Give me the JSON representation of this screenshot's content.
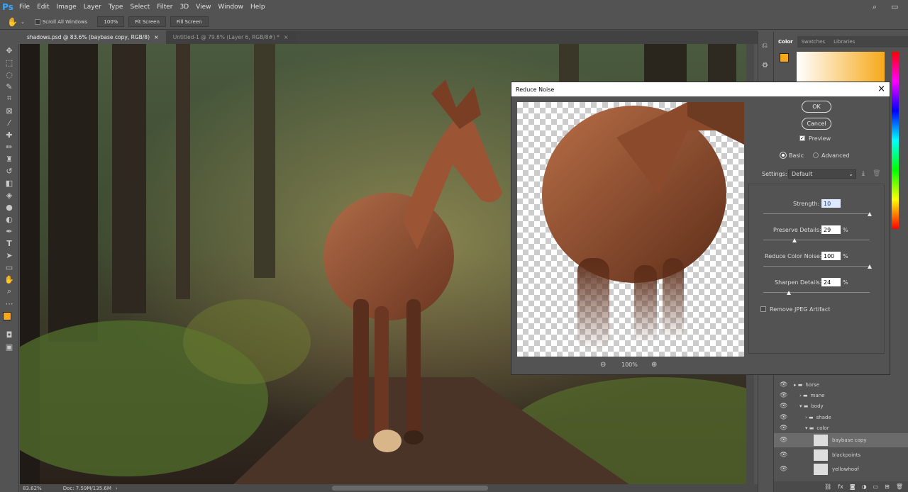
{
  "app": {
    "logo": "Ps"
  },
  "menubar": {
    "items": [
      "File",
      "Edit",
      "Image",
      "Layer",
      "Type",
      "Select",
      "Filter",
      "3D",
      "View",
      "Window",
      "Help"
    ]
  },
  "options": {
    "scroll_all_windows": "Scroll All Windows",
    "zoom_100": "100%",
    "fit_screen": "Fit Screen",
    "fill_screen": "Fill Screen"
  },
  "tabs": [
    {
      "label": "shadows.psd @ 83.6% (baybase copy, RGB/8)",
      "close": "×"
    },
    {
      "label": "Untitled-1 @ 79.8% (Layer 6, RGB/8#) *",
      "close": "×"
    }
  ],
  "status": {
    "zoom": "83.62%",
    "doc": "Doc: 7.59M/135.6M"
  },
  "panels": {
    "tabs": [
      "Color",
      "Swatches",
      "Libraries"
    ]
  },
  "colors": {
    "foreground": "#f7a91a",
    "background": "#ffffff",
    "accent": "#31a8ff"
  },
  "layers": [
    {
      "name": "horse",
      "type": "group",
      "indent": 0
    },
    {
      "name": "mane",
      "type": "group",
      "indent": 1
    },
    {
      "name": "body",
      "type": "group",
      "indent": 1
    },
    {
      "name": "shade",
      "type": "group",
      "indent": 2
    },
    {
      "name": "color",
      "type": "group",
      "indent": 2
    },
    {
      "name": "baybase copy",
      "type": "layer",
      "indent": 3,
      "selected": true
    },
    {
      "name": "blackpoints",
      "type": "layer",
      "indent": 3
    },
    {
      "name": "yellowhoof",
      "type": "layer",
      "indent": 3
    }
  ],
  "dialog": {
    "title": "Reduce Noise",
    "close": "×",
    "ok": "OK",
    "cancel": "Cancel",
    "preview_label": "Preview",
    "mode_basic": "Basic",
    "mode_advanced": "Advanced",
    "settings_label": "Settings:",
    "settings_value": "Default",
    "zoom": "100%",
    "strength_label": "Strength:",
    "strength_value": "10",
    "preserve_label": "Preserve Details:",
    "preserve_value": "29",
    "colornoise_label": "Reduce Color Noise:",
    "colornoise_value": "100",
    "sharpen_label": "Sharpen Details:",
    "sharpen_value": "24",
    "percent": "%",
    "jpeg_label": "Remove JPEG Artifact",
    "levels": {
      "strength": 1.0,
      "preserve": 0.29,
      "colornoise": 1.0,
      "sharpen": 0.24
    }
  }
}
